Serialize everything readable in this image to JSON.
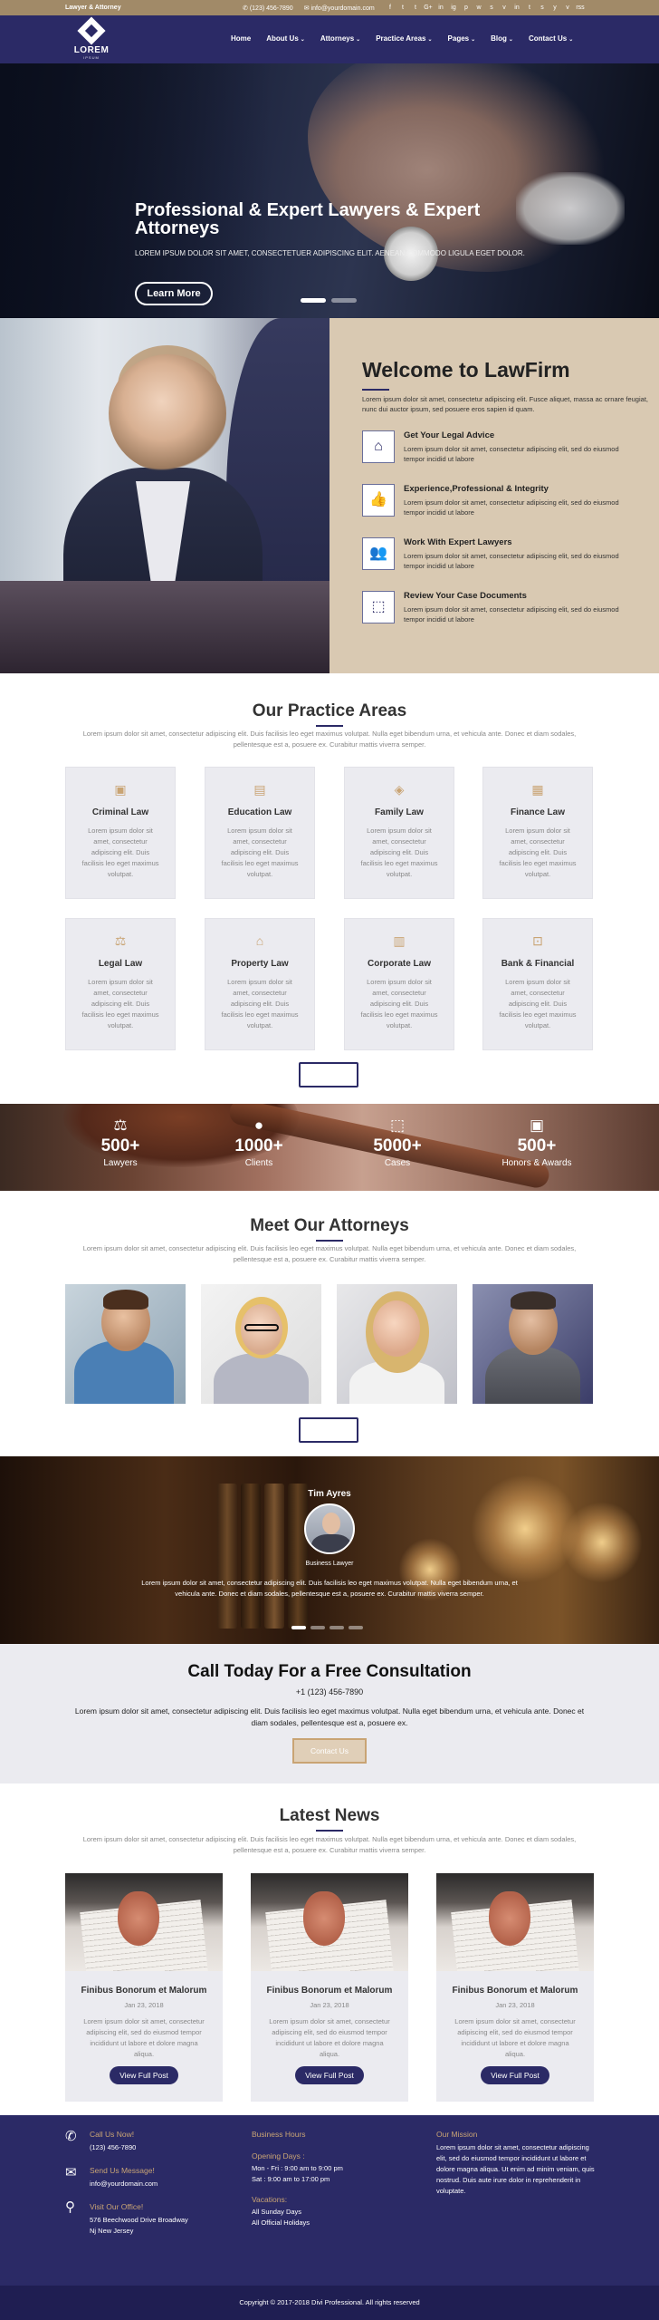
{
  "topbar": {
    "tagline": "Lawyer & Attorney",
    "phone": "(123) 456-7890",
    "email": "info@yourdomain.com",
    "socials": [
      "f",
      "t",
      "t",
      "G+",
      "in",
      "ig",
      "p",
      "w",
      "s",
      "v",
      "in",
      "t",
      "s",
      "y",
      "v",
      "rss"
    ]
  },
  "header": {
    "logo_name": "LOREM",
    "logo_sub": "IPSUM",
    "nav": [
      {
        "label": "Home",
        "caret": false
      },
      {
        "label": "About Us",
        "caret": true
      },
      {
        "label": "Attorneys",
        "caret": true
      },
      {
        "label": "Practice Areas",
        "caret": true
      },
      {
        "label": "Pages",
        "caret": true
      },
      {
        "label": "Blog",
        "caret": true
      },
      {
        "label": "Contact Us",
        "caret": true
      }
    ]
  },
  "hero": {
    "title": "Professional & Expert Lawyers & Expert Attorneys",
    "text": "LOREM IPSUM DOLOR SIT AMET, CONSECTETUER ADIPISCING ELIT. AENEAN COMMODO LIGULA EGET DOLOR.",
    "button": "Learn More"
  },
  "welcome": {
    "title": "Welcome to LawFirm",
    "intro": "Lorem ipsum dolor sit amet, consectetur adipiscing elit. Fusce aliquet, massa ac ornare feugiat, nunc dui auctor ipsum, sed posuere eros sapien id quam.",
    "features": [
      {
        "icon": "house-icon",
        "glyph": "⌂",
        "title": "Get Your Legal Advice",
        "text": "Lorem ipsum dolor sit amet, consectetur adipiscing elit, sed do eiusmod tempor incidid ut labore"
      },
      {
        "icon": "thumbs-up-icon",
        "glyph": "👍",
        "title": "Experience,Professional & Integrity",
        "text": "Lorem ipsum dolor sit amet, consectetur adipiscing elit, sed do eiusmod tempor incidid ut labore"
      },
      {
        "icon": "people-icon",
        "glyph": "👥",
        "title": "Work With Expert Lawyers",
        "text": "Lorem ipsum dolor sit amet, consectetur adipiscing elit, sed do eiusmod tempor incidid ut labore"
      },
      {
        "icon": "document-icon",
        "glyph": "⬚",
        "title": "Review Your Case Documents",
        "text": "Lorem ipsum dolor sit amet, consectetur adipiscing elit, sed do eiusmod tempor incidid ut labore"
      }
    ]
  },
  "practice": {
    "title": "Our Practice Areas",
    "subtitle": "Lorem ipsum dolor sit amet, consectetur adipiscing elit. Duis facilisis leo eget maximus volutpat. Nulla eget bibendum urna, et vehicula ante. Donec et diam sodales, pellentesque est a, posuere ex. Curabitur mattis viverra semper.",
    "card_text": "Lorem ipsum dolor sit amet, consectetur adipiscing elit. Duis facilisis leo eget maximus volutpat.",
    "areas": [
      {
        "title": "Criminal Law",
        "icon": "wallet-icon",
        "glyph": "▣"
      },
      {
        "title": "Education Law",
        "icon": "briefcase-icon",
        "glyph": "▤"
      },
      {
        "title": "Family Law",
        "icon": "family-icon",
        "glyph": "◈"
      },
      {
        "title": "Finance Law",
        "icon": "calculator-icon",
        "glyph": "▦"
      },
      {
        "title": "Legal Law",
        "icon": "gavel-icon",
        "glyph": "⚖"
      },
      {
        "title": "Property Law",
        "icon": "home-icon",
        "glyph": "⌂"
      },
      {
        "title": "Corporate Law",
        "icon": "building-icon",
        "glyph": "▥"
      },
      {
        "title": "Bank & Financial",
        "icon": "lock-icon",
        "glyph": "⊡"
      }
    ]
  },
  "counters": [
    {
      "icon": "scales-icon",
      "glyph": "⚖",
      "value": "500+",
      "label": "Lawyers"
    },
    {
      "icon": "person-icon",
      "glyph": "●",
      "value": "1000+",
      "label": "Clients"
    },
    {
      "icon": "document-icon",
      "glyph": "⬚",
      "value": "5000+",
      "label": "Cases"
    },
    {
      "icon": "gift-icon",
      "glyph": "▣",
      "value": "500+",
      "label": "Honors & Awards"
    }
  ],
  "attorneys": {
    "title": "Meet Our Attorneys",
    "subtitle": "Lorem ipsum dolor sit amet, consectetur adipiscing elit. Duis facilisis leo eget maximus volutpat. Nulla eget bibendum urna, et vehicula ante. Donec et diam sodales, pellentesque est a, posuere ex. Curabitur mattis viverra semper."
  },
  "testimonial": {
    "name": "Tim Ayres",
    "role": "Business Lawyer",
    "quote": "Lorem ipsum dolor sit amet, consectetur adipiscing elit. Duis facilisis leo eget maximus volutpat. Nulla eget bibendum urna, et vehicula ante. Donec et diam sodales, pellentesque est a, posuere ex. Curabitur mattis viverra semper."
  },
  "consult": {
    "title": "Call Today For a Free Consultation",
    "phone": "+1 (123) 456-7890",
    "text": "Lorem ipsum dolor sit amet, consectetur adipiscing elit. Duis facilisis leo eget maximus volutpat. Nulla eget bibendum urna, et vehicula ante. Donec et diam sodales, pellentesque est a, posuere ex.",
    "button": "Contact Us"
  },
  "news": {
    "title": "Latest News",
    "subtitle": "Lorem ipsum dolor sit amet, consectetur adipiscing elit. Duis facilisis leo eget maximus volutpat. Nulla eget bibendum urna, et vehicula ante. Donec et diam sodales, pellentesque est a, posuere ex. Curabitur mattis viverra semper.",
    "posts": [
      {
        "title": "Finibus Bonorum et Malorum",
        "date": "Jan 23, 2018",
        "excerpt": "Lorem ipsum dolor sit amet, consectetur adipiscing elit, sed do eiusmod tempor incididunt ut labore et dolore magna aliqua.",
        "button": "View Full Post"
      },
      {
        "title": "Finibus Bonorum et Malorum",
        "date": "Jan 23, 2018",
        "excerpt": "Lorem ipsum dolor sit amet, consectetur adipiscing elit, sed do eiusmod tempor incididunt ut labore et dolore magna aliqua.",
        "button": "View Full Post"
      },
      {
        "title": "Finibus Bonorum et Malorum",
        "date": "Jan 23, 2018",
        "excerpt": "Lorem ipsum dolor sit amet, consectetur adipiscing elit, sed do eiusmod tempor incididunt ut labore et dolore magna aliqua.",
        "button": "View Full Post"
      }
    ]
  },
  "footer": {
    "call_title": "Call Us Now!",
    "call_value": "(123) 456-7890",
    "mail_title": "Send Us Message!",
    "mail_value": "info@yourdomain.com",
    "visit_title": "Visit Our Office!",
    "visit_value": "576 Beechwood Drive Broadway Nj New Jersey",
    "hours_title": "Business Hours",
    "opening_title": "Opening Days :",
    "opening_1": "Mon - Fri : 9:00 am to 9:00 pm",
    "opening_2": "Sat : 9:00 am to 17:00 pm",
    "vacations_title": "Vacations:",
    "vacations_1": "All Sunday Days",
    "vacations_2": "All Official Holidays",
    "mission_title": "Our Mission",
    "mission_text": "Lorem ipsum dolor sit amet, consectetur adipiscing elit, sed do eiusmod tempor incididunt ut labore et dolore magna aliqua. Ut enim ad minim veniam, quis nostrud. Duis aute irure dolor in reprehenderit in voluptate.",
    "copyright": "Copyright © 2017-2018 Divi Professional. All rights reserved"
  },
  "colors": {
    "primary": "#2b2a66",
    "accent": "#c9a474",
    "topbar": "#a18a68",
    "welcome_bg": "#d9c9b2",
    "card_bg": "#ebebf0"
  }
}
